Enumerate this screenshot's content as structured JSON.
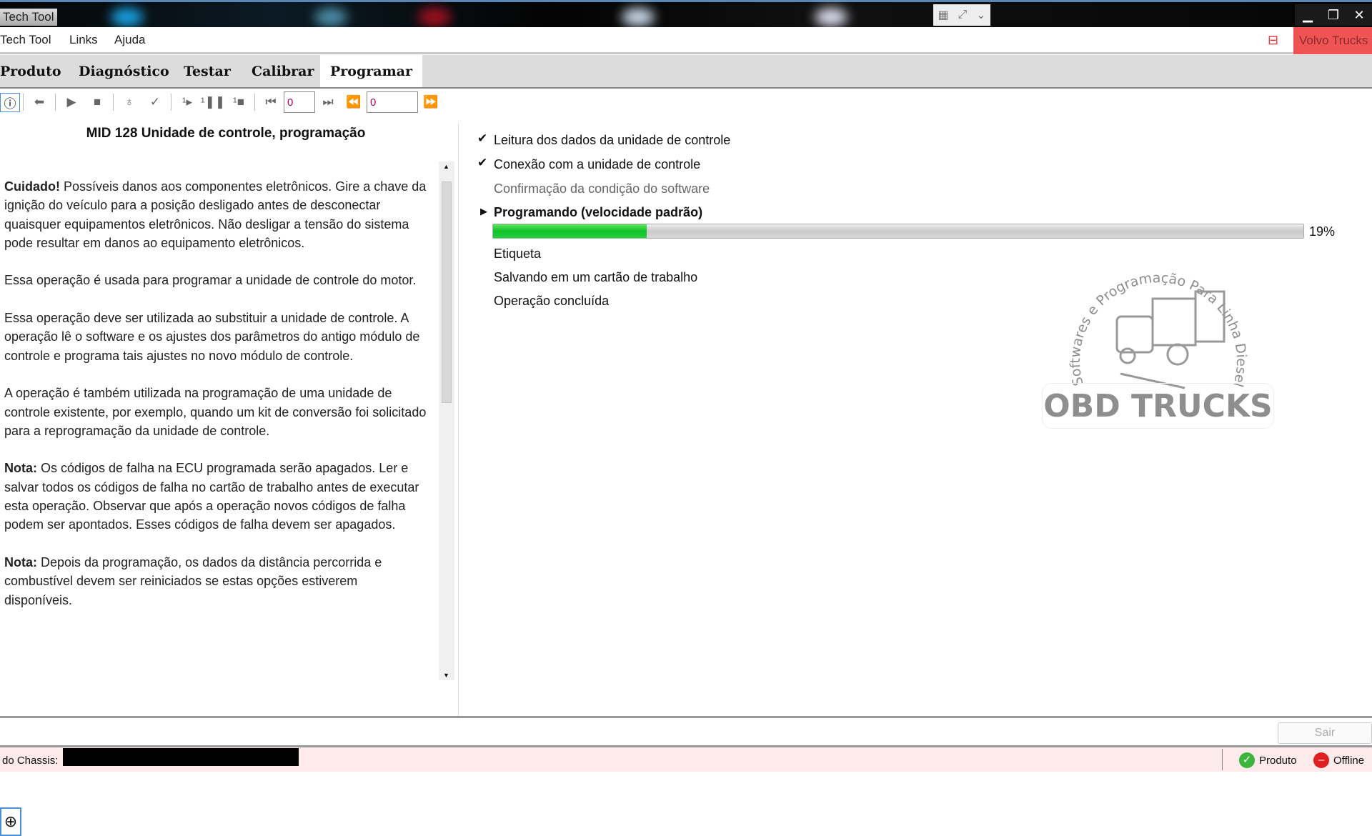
{
  "window": {
    "title": "Tech Tool"
  },
  "menu": {
    "items": [
      "Tech Tool",
      "Links",
      "Ajuda"
    ],
    "brand": "Volvo Trucks"
  },
  "tabs": [
    {
      "label": "Produto"
    },
    {
      "label": "Diagnóstico"
    },
    {
      "label": "Testar"
    },
    {
      "label": "Calibrar"
    },
    {
      "label": "Programar",
      "active": true
    }
  ],
  "toolbar": {
    "counter1": "0",
    "counter2": "0"
  },
  "left": {
    "title": "MID 128 Unidade de controle, programação",
    "p1_bold": "Cuidado!",
    "p1": " Possíveis danos aos componentes eletrônicos. Gire a chave da ignição do veículo para a posição desligado antes de desconectar quaisquer equipamentos eletrônicos. Não desligar a tensão do sistema pode resultar em danos ao equipamento eletrônicos.",
    "p2": "Essa operação é usada para programar a unidade de controle do motor.",
    "p3": "Essa operação deve ser utilizada ao substituir a unidade de controle. A operação lê o software e os ajustes dos parâmetros do antigo módulo de controle e programa tais ajustes no novo módulo de controle.",
    "p4": "A operação é também utilizada na programação de uma unidade de controle existente, por exemplo, quando um kit de conversão foi solicitado para a reprogramação da unidade de controle.",
    "p5_bold": "Nota:",
    "p5": " Os códigos de falha na ECU programada serão apagados. Ler e salvar todos os códigos de falha no cartão de trabalho antes de executar esta operação. Observar que após a operação novos códigos de falha podem ser apontados. Esses códigos de falha devem ser apagados.",
    "p6_bold": "Nota:",
    "p6": " Depois da programação, os dados da distância percorrida e combustível devem ser reiniciados se estas opções estiverem disponíveis."
  },
  "steps": [
    {
      "label": "Leitura dos dados da unidade de controle",
      "state": "done"
    },
    {
      "label": "Conexão com a unidade de controle",
      "state": "done"
    },
    {
      "label": "Confirmação da condição do software",
      "state": "skipped"
    },
    {
      "label": "Programando (velocidade padrão)",
      "state": "active"
    },
    {
      "label": "Etiqueta",
      "state": "pending"
    },
    {
      "label": "Salvando em um cartão de trabalho",
      "state": "pending"
    },
    {
      "label": "Operação concluída",
      "state": "pending"
    }
  ],
  "progress": {
    "value": 19,
    "label": "19%",
    "color": "#10c22a"
  },
  "watermark": {
    "arc_text": "Softwares e Programação Para Linha Diesel Pesado",
    "name": "OBD TRUCKS"
  },
  "actions": {
    "exit": "Sair"
  },
  "status": {
    "chassis_label": "do Chassis:",
    "product": "Produto",
    "connection": "Offline"
  }
}
